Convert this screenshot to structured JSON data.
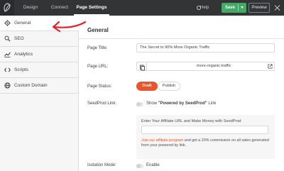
{
  "topbar": {
    "logo_icon": "seedprod-leaf-icon",
    "tabs": [
      {
        "label": "Design"
      },
      {
        "label": "Connect"
      },
      {
        "label": "Page Settings"
      }
    ],
    "help_label": "Help",
    "save_label": "Save",
    "preview_label": "Preview",
    "close_icon": "close-icon",
    "colors": {
      "bar": "#333436",
      "save": "#45a866"
    }
  },
  "sidebar": {
    "items": [
      {
        "label": "General",
        "icon": "gear-icon",
        "active": true
      },
      {
        "label": "SEO",
        "icon": "search-icon",
        "active": false
      },
      {
        "label": "Analytics",
        "icon": "chart-icon",
        "active": false
      },
      {
        "label": "Scripts",
        "icon": "code-icon",
        "active": false
      },
      {
        "label": "Custom Domain",
        "icon": "globe-icon",
        "active": false
      }
    ]
  },
  "general": {
    "title": "General",
    "page_title_label": "Page Title:",
    "page_title_value": "The Secret to 90% More Organic Traffic",
    "page_url_label": "Page URL:",
    "page_url_slug": "more-organic-traffic",
    "page_status_label": "Page Status:",
    "status_options": [
      "Draft",
      "Publish"
    ],
    "status_selected": "Draft",
    "seedprod_link_label": "SeedProd Link:",
    "seedprod_link_prefix": "Show ",
    "seedprod_link_bold": "\"Powered by SeedProd\"",
    "seedprod_link_suffix": " Link",
    "affiliate_prompt": "Enter Your Affiliate URL and Make Money with SeedProd",
    "affiliate_link_text": "Join our affiliate program",
    "affiliate_note_rest": " and get a 20% commission on all sales generated from your powered by link.",
    "isolation_label": "Isolation Mode:",
    "isolation_toggle_label": "Enable",
    "accent_color": "#e8572c"
  }
}
